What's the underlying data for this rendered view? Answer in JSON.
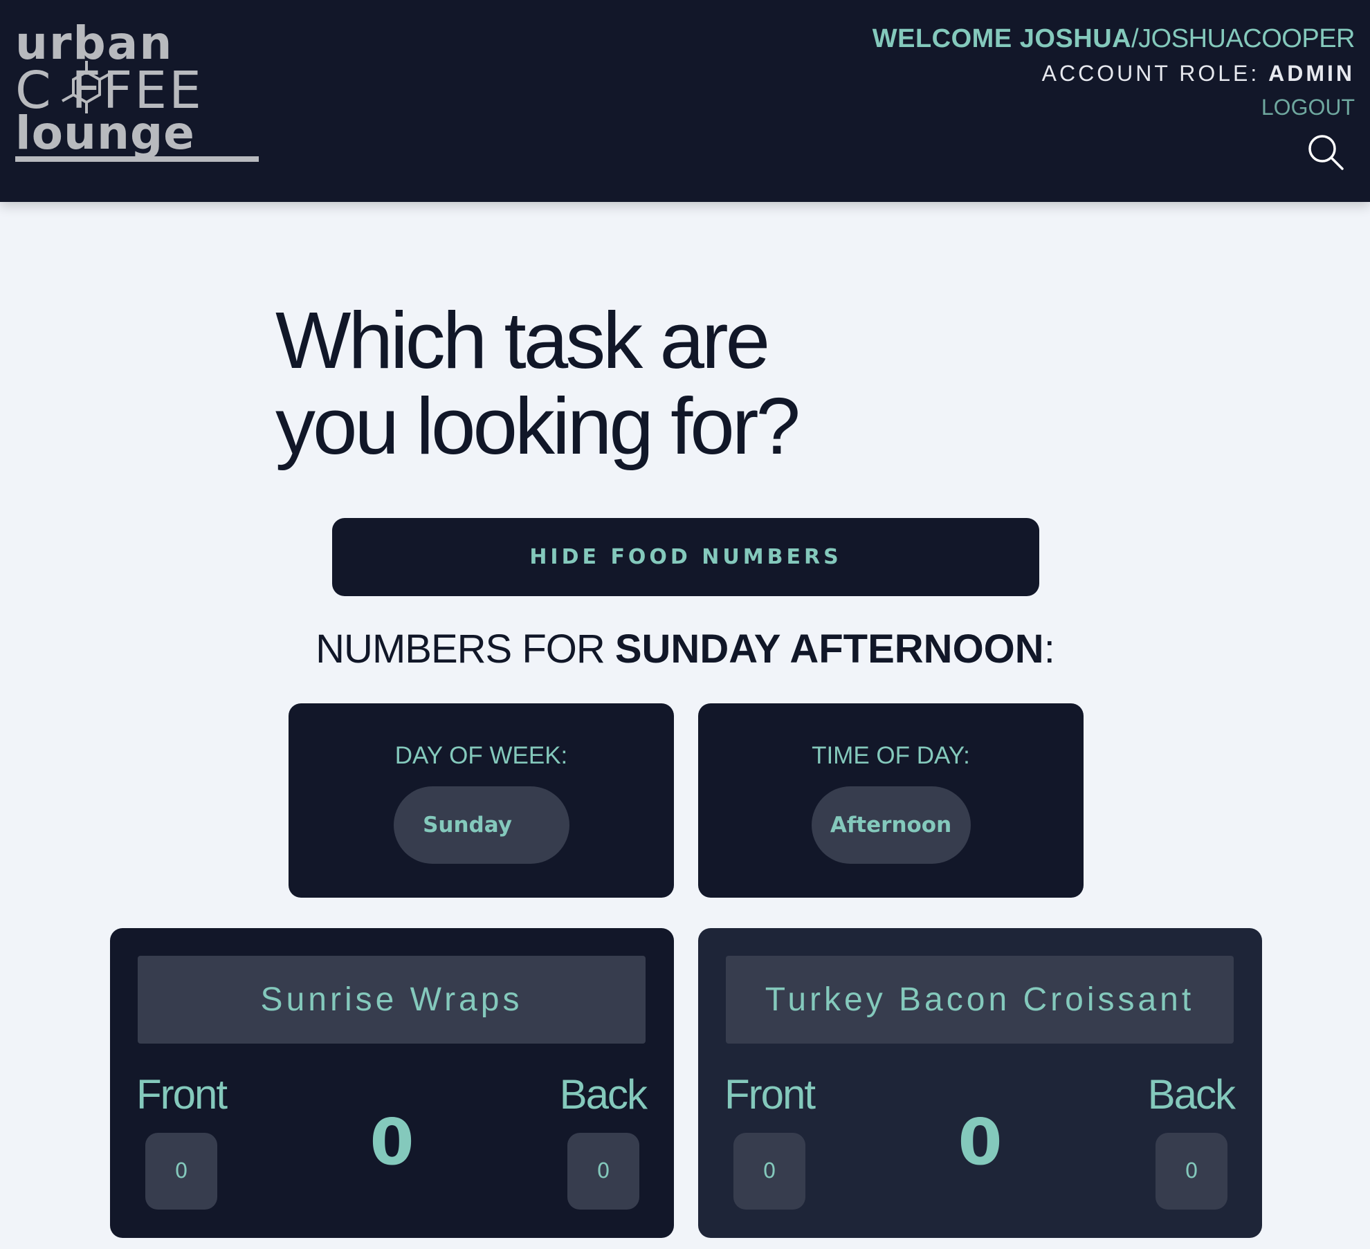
{
  "header": {
    "logo": {
      "line1": "urban",
      "line2": "C  FFEE",
      "line3": "lounge"
    },
    "welcome_prefix": "WELCOME JOSHUA",
    "welcome_separator": "/",
    "username": "JOSHUACOOPER",
    "role_label": "ACCOUNT ROLE:",
    "role_value": "ADMIN",
    "logout_label": "LOGOUT",
    "search_icon": "search-icon"
  },
  "main": {
    "headline_line1": "Which task are",
    "headline_line2": "you looking for?",
    "hide_button_label": "HIDE FOOD NUMBERS",
    "numbers_for_prefix": "NUMBERS FOR ",
    "numbers_for_value": "SUNDAY AFTERNOON",
    "numbers_for_suffix": ":",
    "day_selector": {
      "label": "DAY OF WEEK:",
      "value": "Sunday"
    },
    "time_selector": {
      "label": "TIME OF DAY:",
      "value": "Afternoon"
    },
    "food_items": [
      {
        "name": "Sunrise Wraps",
        "front_label": "Front",
        "back_label": "Back",
        "front_count": "0",
        "back_count": "0",
        "total": "0"
      },
      {
        "name": "Turkey Bacon Croissant",
        "front_label": "Front",
        "back_label": "Back",
        "front_count": "0",
        "back_count": "0",
        "total": "0"
      }
    ]
  },
  "colors": {
    "navy": "#121729",
    "navy_alt": "#1e2538",
    "slate": "#373d4e",
    "accent": "#84c9bc",
    "background": "#f1f4f9"
  }
}
